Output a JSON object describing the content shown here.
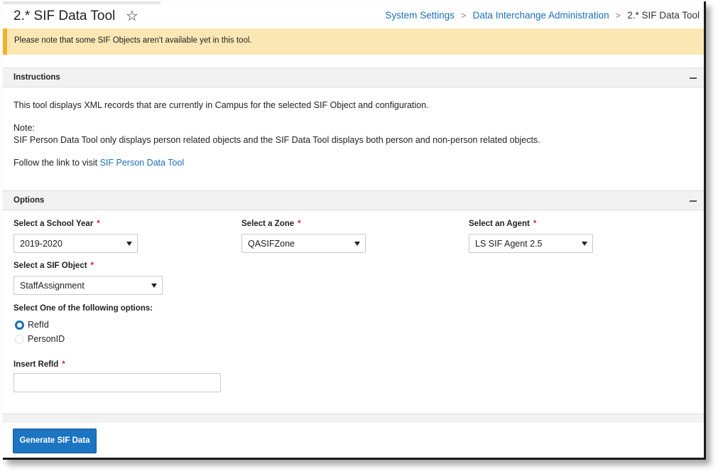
{
  "header": {
    "title": "2.* SIF Data Tool",
    "breadcrumb": [
      "System Settings",
      "Data Interchange Administration",
      "2.* SIF Data Tool"
    ]
  },
  "notice": "Please note that some SIF Objects aren't available yet in this tool.",
  "instructions": {
    "heading": "Instructions",
    "line1": "This tool displays XML records that are currently in Campus for the selected SIF Object and configuration.",
    "note_label": "Note:",
    "note_text": "SIF Person Data Tool only displays person related objects and the SIF Data Tool displays both person and non-person related objects.",
    "follow_text": "Follow the link to visit ",
    "link_text": "SIF Person Data Tool"
  },
  "options": {
    "heading": "Options",
    "school_year": {
      "label": "Select a School Year",
      "value": "2019-2020"
    },
    "zone": {
      "label": "Select a Zone",
      "value": "QASIFZone"
    },
    "agent": {
      "label": "Select an Agent",
      "value": "LS SIF Agent 2.5"
    },
    "sif_object": {
      "label": "Select a SIF Object",
      "value": "StaffAssignment"
    },
    "radio_group_label": "Select One of the following options:",
    "radio_options": [
      "RefId",
      "PersonID"
    ],
    "selected_option": "RefId",
    "insert_label": "Insert RefId",
    "insert_value": "",
    "required_marker": "*"
  },
  "actions": {
    "generate_label": "Generate SIF Data"
  },
  "colors": {
    "link": "#1a6fb5",
    "notice_bg": "#fbe7b4",
    "notice_accent": "#f2b229",
    "primary_button": "#1d74c1",
    "required": "#dd2222"
  }
}
